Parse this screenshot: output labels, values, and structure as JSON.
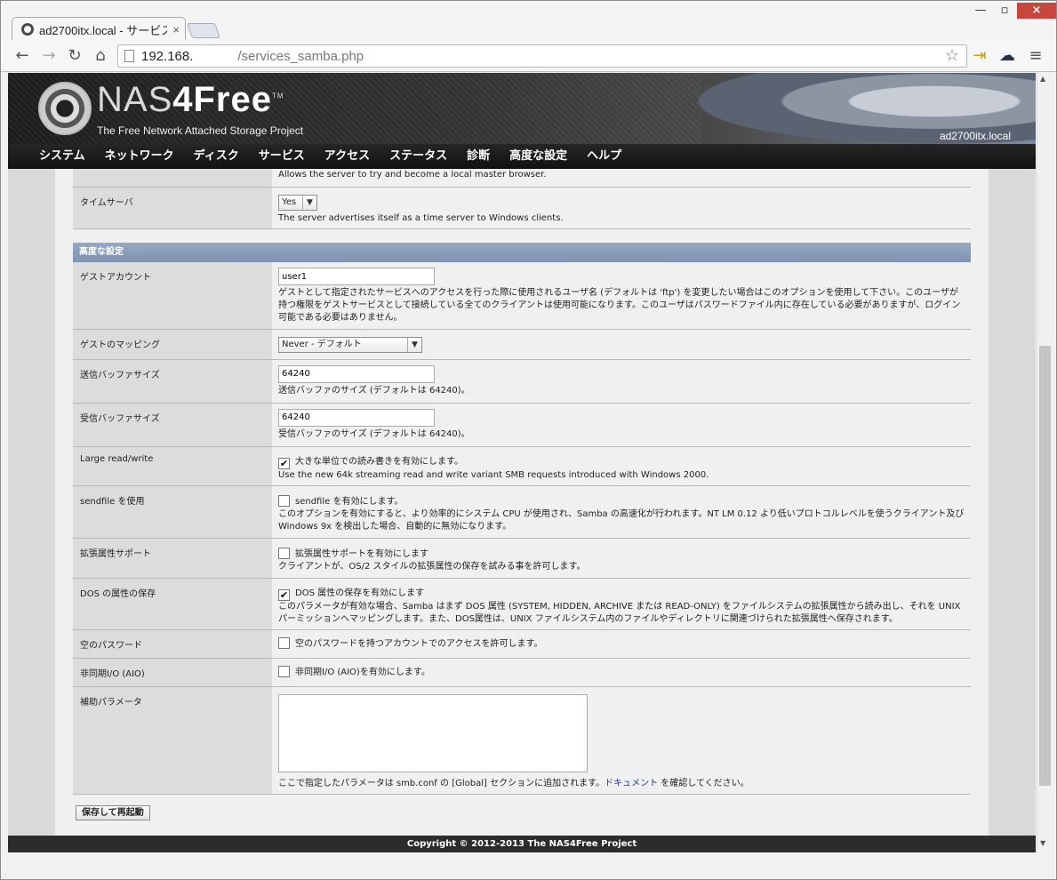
{
  "browser": {
    "tab_title": "ad2700itx.local - サービス",
    "url_host": "192.168.",
    "url_path": "/services_samba.php"
  },
  "header": {
    "logo_nas": "NAS",
    "logo_free": "4Free",
    "logo_tm": "TM",
    "tagline": "The Free Network Attached Storage Project",
    "hostname": "ad2700itx.local"
  },
  "menu": [
    "システム",
    "ネットワーク",
    "ディスク",
    "サービス",
    "アクセス",
    "ステータス",
    "診断",
    "高度な設定",
    "ヘルプ"
  ],
  "top_rows": {
    "master_browser_desc": "Allows the server to try and become a local master browser.",
    "time_server_label": "タイムサーバ",
    "time_server_value": "Yes",
    "time_server_desc": "The server advertises itself as a time server to Windows clients."
  },
  "advanced": {
    "section_title": "高度な設定",
    "guest_account_label": "ゲストアカウント",
    "guest_account_value": "user1",
    "guest_account_desc": "ゲストとして指定されたサービスへのアクセスを行った際に使用されるユーザ名 (デフォルトは 'ftp') を変更したい場合はこのオプションを使用して下さい。このユーザが持つ権限をゲストサービスとして接続している全てのクライアントは使用可能になります。このユーザはパスワードファイル内に存在している必要がありますが、ログイン可能である必要はありません。",
    "guest_mapping_label": "ゲストのマッピング",
    "guest_mapping_value": "Never - デフォルト",
    "send_buffer_label": "送信バッファサイズ",
    "send_buffer_value": "64240",
    "send_buffer_desc": "送信バッファのサイズ (デフォルトは 64240)。",
    "recv_buffer_label": "受信バッファサイズ",
    "recv_buffer_value": "64240",
    "recv_buffer_desc": "受信バッファのサイズ (デフォルトは 64240)。",
    "large_rw_label": "Large read/write",
    "large_rw_check": "大きな単位での読み書きを有効にします。",
    "large_rw_desc": "Use the new 64k streaming read and write variant SMB requests introduced with Windows 2000.",
    "sendfile_label": "sendfile を使用",
    "sendfile_check": "sendfile を有効にします。",
    "sendfile_desc": "このオプションを有効にすると、より効率的にシステム CPU が使用され、Samba の高速化が行われます。NT LM 0.12 より低いプロトコルレベルを使うクライアント及び Windows 9x を検出した場合、自動的に無効になります。",
    "ea_label": "拡張属性サポート",
    "ea_check": "拡張属性サポートを有効にします",
    "ea_desc": "クライアントが、OS/2 スタイルの拡張属性の保存を試みる事を許可します。",
    "dos_label": "DOS の属性の保存",
    "dos_check": "DOS 属性の保存を有効にします",
    "dos_desc": "このパラメータが有効な場合、Samba はまず DOS 属性 (SYSTEM, HIDDEN, ARCHIVE または READ-ONLY) をファイルシステムの拡張属性から読み出し、それを UNIX パーミッションへマッピングします。また、DOS属性は、UNIX ファイルシステム内のファイルやディレクトリに関連づけられた拡張属性へ保存されます。",
    "nullpw_label": "空のパスワード",
    "nullpw_check": "空のパスワードを持つアカウントでのアクセスを許可します。",
    "aio_label": "非同期I/O (AIO)",
    "aio_check": "非同期I/O (AIO)を有効にします。",
    "aux_label": "補助パラメータ",
    "aux_desc_pre": "ここで指定したパラメータは smb.conf の [Global] セクションに追加されます。",
    "aux_link": "ドキュメント",
    "aux_desc_post": " を確認してください。"
  },
  "save_button": "保存して再起動",
  "footer": "Copyright © 2012-2013 The NAS4Free Project"
}
